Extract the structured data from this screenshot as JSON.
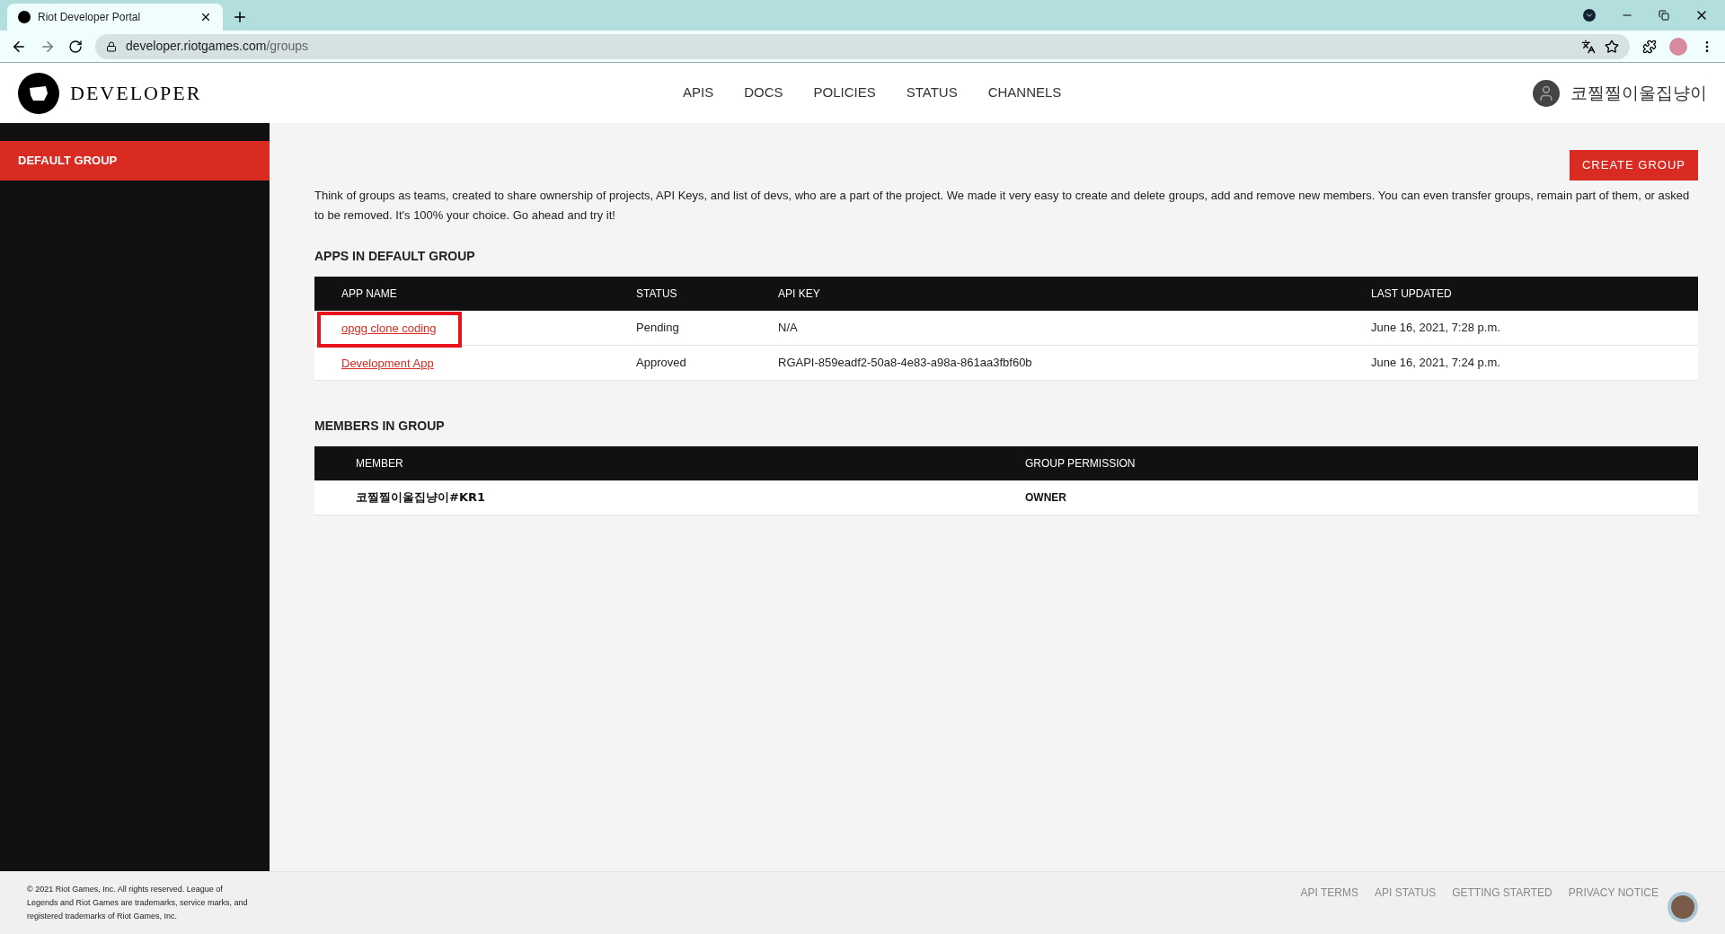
{
  "browser": {
    "tab_title": "Riot Developer Portal",
    "url_host": "developer.riotgames.com",
    "url_path": "/groups"
  },
  "header": {
    "logo_text": "DEVELOPER",
    "nav": [
      "APIS",
      "DOCS",
      "POLICIES",
      "STATUS",
      "CHANNELS"
    ],
    "user_name": "코찔찔이울집냥이"
  },
  "sidebar": {
    "items": [
      {
        "label": "DEFAULT GROUP",
        "selected": true
      }
    ]
  },
  "create_button": "CREATE GROUP",
  "intro": "Think of groups as teams, created to share ownership of projects, API Keys, and list of devs, who are a part of the project. We made it very easy to create and delete groups, add and remove new members. You can even transfer groups, remain part of them, or asked to be removed. It's 100% your choice. Go ahead and try it!",
  "apps": {
    "title": "APPS IN DEFAULT GROUP",
    "columns": [
      "APP NAME",
      "STATUS",
      "API KEY",
      "LAST UPDATED"
    ],
    "rows": [
      {
        "name": "opgg clone coding",
        "status": "Pending",
        "api_key": "N/A",
        "updated": "June 16, 2021, 7:28 p.m.",
        "highlighted": true
      },
      {
        "name": "Development App",
        "status": "Approved",
        "api_key": "RGAPI-859eadf2-50a8-4e83-a98a-861aa3fbf60b",
        "updated": "June 16, 2021, 7:24 p.m.",
        "highlighted": false
      }
    ]
  },
  "members": {
    "title": "MEMBERS IN GROUP",
    "columns": [
      "MEMBER",
      "GROUP PERMISSION"
    ],
    "rows": [
      {
        "member": "코찔찔이울집냥이#KR1",
        "permission": "OWNER"
      }
    ]
  },
  "footer": {
    "copyright": "© 2021 Riot Games, Inc. All rights reserved. League of Legends and Riot Games are trademarks, service marks, and registered trademarks of Riot Games, Inc.",
    "links": [
      "API TERMS",
      "API STATUS",
      "GETTING STARTED",
      "PRIVACY NOTICE"
    ]
  }
}
